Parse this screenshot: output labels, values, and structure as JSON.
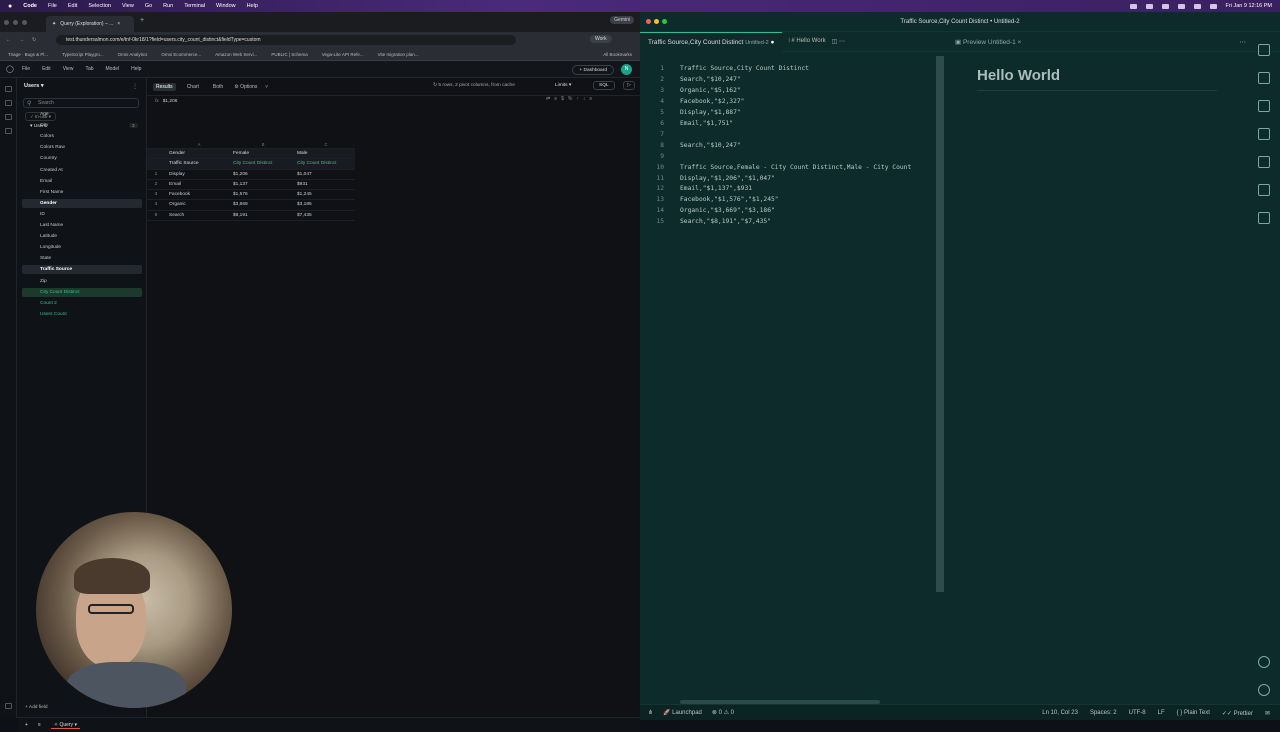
{
  "menubar": {
    "apple": "",
    "items": [
      "Code",
      "File",
      "Edit",
      "Selection",
      "View",
      "Go",
      "Run",
      "Terminal",
      "Window",
      "Help"
    ],
    "clock": "Fri Jan 9  12:16 PM"
  },
  "browser": {
    "tab_title": "Query (Exploration) – ...",
    "tab_right": "Gemini",
    "url": "test.thundersalmon.com/e/tnf-0kr18/1?field=users.city_count_distinct&fieldType=custom",
    "profile": "Work",
    "bookmarks": [
      "Triage · Bugs & Pl...",
      "TypeScript Playgro...",
      "Omni Analytics",
      "Omni Ecommerce...",
      "Amazon Web Servi...",
      "PUBLIC | Schema",
      "Vega-Lite API Refe...",
      "Vite migration plan...",
      "All Bookmarks"
    ]
  },
  "appnav": {
    "items": [
      "File",
      "Edit",
      "View",
      "Tab",
      "Model",
      "Help"
    ],
    "dashboard": "+ Dashboard",
    "avatar": "N"
  },
  "sidebar": {
    "topic": "Users",
    "search_placeholder": "Search",
    "in_use": "In-use",
    "group": "Users",
    "group_count": "3",
    "fields": [
      {
        "label": "Age"
      },
      {
        "label": "City"
      },
      {
        "label": "Colors"
      },
      {
        "label": "Colors Raw"
      },
      {
        "label": "Country"
      },
      {
        "label": "Created At"
      },
      {
        "label": "Email"
      },
      {
        "label": "First Name"
      },
      {
        "label": "Gender"
      },
      {
        "label": "ID"
      },
      {
        "label": "Last Name"
      },
      {
        "label": "Latitude"
      },
      {
        "label": "Longitude"
      },
      {
        "label": "State"
      },
      {
        "label": "Traffic Source"
      },
      {
        "label": "Zip"
      },
      {
        "label": "City Count Distinct"
      },
      {
        "label": "Count 2"
      },
      {
        "label": "Users Count"
      }
    ],
    "add_field": "Add field"
  },
  "query": {
    "tabs": [
      "Results",
      "Chart",
      "Both"
    ],
    "options": "Options",
    "info": "5 rows, 2 pivot columns, from cache",
    "limits": "Limits",
    "sql": "SQL",
    "formula_value": "$1,206",
    "table": {
      "col_idx": [
        "",
        "A",
        "B",
        "C"
      ],
      "pivot_header": [
        "",
        "Gender",
        "Female",
        "Male"
      ],
      "header": [
        "",
        "Traffic Source",
        "City Count Distinct",
        "City Count Distinct"
      ],
      "rows": [
        [
          "1",
          "Display",
          "$1,206",
          "$1,047"
        ],
        [
          "2",
          "Email",
          "$1,137",
          "$931"
        ],
        [
          "3",
          "Facebook",
          "$1,576",
          "$1,245"
        ],
        [
          "4",
          "Organic",
          "$3,669",
          "$3,186"
        ],
        [
          "5",
          "Search",
          "$8,191",
          "$7,435"
        ]
      ]
    },
    "bottom_tab": "Query"
  },
  "vscode": {
    "title": "Traffic Source,City Count Distinct • Untitled-2",
    "tab1": "Traffic Source,City Count Distinct",
    "tab1_sub": "Untitled-2",
    "tab2": "# Hello Work",
    "preview_tab": "Preview Untitled-1",
    "lines": [
      "Traffic Source,City Count Distinct",
      "Search,\"$10,247\"",
      "Organic,\"$5,162\"",
      "Facebook,\"$2,327\"",
      "Display,\"$1,887\"",
      "Email,\"$1,751\"",
      "",
      "Search,\"$10,247\"",
      "",
      "Traffic Source,Female - City Count Distinct,Male - City Count",
      "Display,\"$1,206\",\"$1,047\"",
      "Email,\"$1,137\",$931",
      "Facebook,\"$1,576\",\"$1,245\"",
      "Organic,\"$3,669\",\"$3,186\"",
      "Search,\"$8,191\",\"$7,435\""
    ],
    "preview_heading": "Hello World",
    "status": {
      "launchpad": "Launchpad",
      "errors": "0",
      "warnings": "0",
      "position": "Ln 10, Col 23",
      "spaces": "Spaces: 2",
      "encoding": "UTF-8",
      "eol": "LF",
      "language": "Plain Text",
      "formatter": "Prettier"
    }
  }
}
